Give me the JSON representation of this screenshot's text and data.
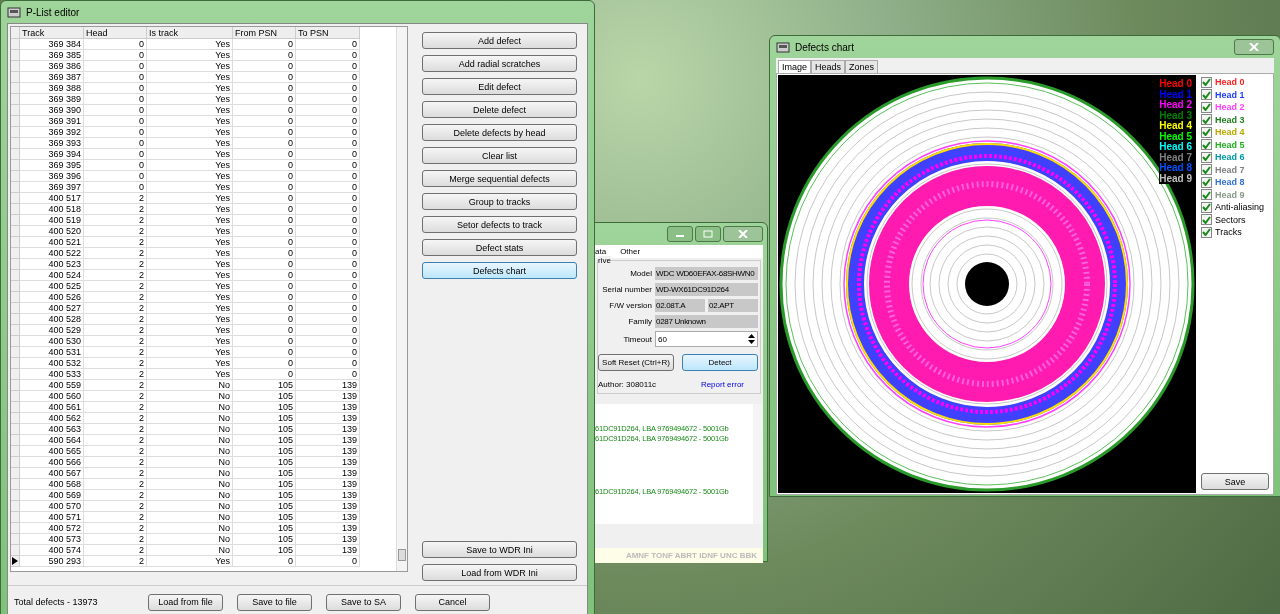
{
  "plist_editor": {
    "title": "P-List editor",
    "columns": [
      "Track",
      "Head",
      "Is track",
      "From PSN",
      "To PSN"
    ],
    "rows": [
      {
        "track": "369 384",
        "head": "0",
        "is_track": "Yes",
        "from_psn": "0",
        "to_psn": "0",
        "selected": false
      },
      {
        "track": "369 385",
        "head": "0",
        "is_track": "Yes",
        "from_psn": "0",
        "to_psn": "0",
        "selected": false
      },
      {
        "track": "369 386",
        "head": "0",
        "is_track": "Yes",
        "from_psn": "0",
        "to_psn": "0",
        "selected": false
      },
      {
        "track": "369 387",
        "head": "0",
        "is_track": "Yes",
        "from_psn": "0",
        "to_psn": "0",
        "selected": false
      },
      {
        "track": "369 388",
        "head": "0",
        "is_track": "Yes",
        "from_psn": "0",
        "to_psn": "0",
        "selected": false
      },
      {
        "track": "369 389",
        "head": "0",
        "is_track": "Yes",
        "from_psn": "0",
        "to_psn": "0",
        "selected": false
      },
      {
        "track": "369 390",
        "head": "0",
        "is_track": "Yes",
        "from_psn": "0",
        "to_psn": "0",
        "selected": false
      },
      {
        "track": "369 391",
        "head": "0",
        "is_track": "Yes",
        "from_psn": "0",
        "to_psn": "0",
        "selected": false
      },
      {
        "track": "369 392",
        "head": "0",
        "is_track": "Yes",
        "from_psn": "0",
        "to_psn": "0",
        "selected": false
      },
      {
        "track": "369 393",
        "head": "0",
        "is_track": "Yes",
        "from_psn": "0",
        "to_psn": "0",
        "selected": false
      },
      {
        "track": "369 394",
        "head": "0",
        "is_track": "Yes",
        "from_psn": "0",
        "to_psn": "0",
        "selected": false
      },
      {
        "track": "369 395",
        "head": "0",
        "is_track": "Yes",
        "from_psn": "0",
        "to_psn": "0",
        "selected": false
      },
      {
        "track": "369 396",
        "head": "0",
        "is_track": "Yes",
        "from_psn": "0",
        "to_psn": "0",
        "selected": false
      },
      {
        "track": "369 397",
        "head": "0",
        "is_track": "Yes",
        "from_psn": "0",
        "to_psn": "0",
        "selected": false
      },
      {
        "track": "400 517",
        "head": "2",
        "is_track": "Yes",
        "from_psn": "0",
        "to_psn": "0",
        "selected": false
      },
      {
        "track": "400 518",
        "head": "2",
        "is_track": "Yes",
        "from_psn": "0",
        "to_psn": "0",
        "selected": false
      },
      {
        "track": "400 519",
        "head": "2",
        "is_track": "Yes",
        "from_psn": "0",
        "to_psn": "0",
        "selected": false
      },
      {
        "track": "400 520",
        "head": "2",
        "is_track": "Yes",
        "from_psn": "0",
        "to_psn": "0",
        "selected": false
      },
      {
        "track": "400 521",
        "head": "2",
        "is_track": "Yes",
        "from_psn": "0",
        "to_psn": "0",
        "selected": false
      },
      {
        "track": "400 522",
        "head": "2",
        "is_track": "Yes",
        "from_psn": "0",
        "to_psn": "0",
        "selected": false
      },
      {
        "track": "400 523",
        "head": "2",
        "is_track": "Yes",
        "from_psn": "0",
        "to_psn": "0",
        "selected": false
      },
      {
        "track": "400 524",
        "head": "2",
        "is_track": "Yes",
        "from_psn": "0",
        "to_psn": "0",
        "selected": false
      },
      {
        "track": "400 525",
        "head": "2",
        "is_track": "Yes",
        "from_psn": "0",
        "to_psn": "0",
        "selected": false
      },
      {
        "track": "400 526",
        "head": "2",
        "is_track": "Yes",
        "from_psn": "0",
        "to_psn": "0",
        "selected": false
      },
      {
        "track": "400 527",
        "head": "2",
        "is_track": "Yes",
        "from_psn": "0",
        "to_psn": "0",
        "selected": false
      },
      {
        "track": "400 528",
        "head": "2",
        "is_track": "Yes",
        "from_psn": "0",
        "to_psn": "0",
        "selected": false
      },
      {
        "track": "400 529",
        "head": "2",
        "is_track": "Yes",
        "from_psn": "0",
        "to_psn": "0",
        "selected": false
      },
      {
        "track": "400 530",
        "head": "2",
        "is_track": "Yes",
        "from_psn": "0",
        "to_psn": "0",
        "selected": false
      },
      {
        "track": "400 531",
        "head": "2",
        "is_track": "Yes",
        "from_psn": "0",
        "to_psn": "0",
        "selected": false
      },
      {
        "track": "400 532",
        "head": "2",
        "is_track": "Yes",
        "from_psn": "0",
        "to_psn": "0",
        "selected": false
      },
      {
        "track": "400 533",
        "head": "2",
        "is_track": "Yes",
        "from_psn": "0",
        "to_psn": "0",
        "selected": false
      },
      {
        "track": "400 559",
        "head": "2",
        "is_track": "No",
        "from_psn": "105",
        "to_psn": "139",
        "selected": false
      },
      {
        "track": "400 560",
        "head": "2",
        "is_track": "No",
        "from_psn": "105",
        "to_psn": "139",
        "selected": false
      },
      {
        "track": "400 561",
        "head": "2",
        "is_track": "No",
        "from_psn": "105",
        "to_psn": "139",
        "selected": false
      },
      {
        "track": "400 562",
        "head": "2",
        "is_track": "No",
        "from_psn": "105",
        "to_psn": "139",
        "selected": false
      },
      {
        "track": "400 563",
        "head": "2",
        "is_track": "No",
        "from_psn": "105",
        "to_psn": "139",
        "selected": false
      },
      {
        "track": "400 564",
        "head": "2",
        "is_track": "No",
        "from_psn": "105",
        "to_psn": "139",
        "selected": false
      },
      {
        "track": "400 565",
        "head": "2",
        "is_track": "No",
        "from_psn": "105",
        "to_psn": "139",
        "selected": false
      },
      {
        "track": "400 566",
        "head": "2",
        "is_track": "No",
        "from_psn": "105",
        "to_psn": "139",
        "selected": false
      },
      {
        "track": "400 567",
        "head": "2",
        "is_track": "No",
        "from_psn": "105",
        "to_psn": "139",
        "selected": false
      },
      {
        "track": "400 568",
        "head": "2",
        "is_track": "No",
        "from_psn": "105",
        "to_psn": "139",
        "selected": false
      },
      {
        "track": "400 569",
        "head": "2",
        "is_track": "No",
        "from_psn": "105",
        "to_psn": "139",
        "selected": false
      },
      {
        "track": "400 570",
        "head": "2",
        "is_track": "No",
        "from_psn": "105",
        "to_psn": "139",
        "selected": false
      },
      {
        "track": "400 571",
        "head": "2",
        "is_track": "No",
        "from_psn": "105",
        "to_psn": "139",
        "selected": false
      },
      {
        "track": "400 572",
        "head": "2",
        "is_track": "No",
        "from_psn": "105",
        "to_psn": "139",
        "selected": false
      },
      {
        "track": "400 573",
        "head": "2",
        "is_track": "No",
        "from_psn": "105",
        "to_psn": "139",
        "selected": false
      },
      {
        "track": "400 574",
        "head": "2",
        "is_track": "No",
        "from_psn": "105",
        "to_psn": "139",
        "selected": false
      },
      {
        "track": "590 293",
        "head": "2",
        "is_track": "Yes",
        "from_psn": "0",
        "to_psn": "0",
        "selected": true
      }
    ],
    "actions": [
      {
        "label": "Add defect",
        "focused": false
      },
      {
        "label": "Add radial scratches",
        "focused": false
      },
      {
        "label": "Edit defect",
        "focused": false
      },
      {
        "label": "Delete defect",
        "focused": false
      },
      {
        "label": "Delete defects by head",
        "focused": false
      },
      {
        "label": "Clear list",
        "focused": false
      },
      {
        "label": "Merge sequential defects",
        "focused": false
      },
      {
        "label": "Group to tracks",
        "focused": false
      },
      {
        "label": "Setor defects to track",
        "focused": false
      },
      {
        "label": "Defect stats",
        "focused": false
      },
      {
        "label": "Defects chart",
        "focused": true
      }
    ],
    "ini_buttons": [
      "Save to WDR Ini",
      "Load from WDR Ini"
    ],
    "total": "Total defects - 13973",
    "footer_buttons": [
      "Load from file",
      "Save to file",
      "Save to SA",
      "Cancel"
    ]
  },
  "drive_window": {
    "menu": [
      "ata",
      "Other"
    ],
    "group_title": "rive",
    "fields": [
      {
        "label": "Model",
        "values": [
          "WDC WD60EFAX-68SHWN0"
        ]
      },
      {
        "label": "Serial number",
        "values": [
          "WD-WX61DC91D264"
        ]
      },
      {
        "label": "F/W version",
        "values": [
          "02.08T.A",
          "02.APT"
        ]
      },
      {
        "label": "Family",
        "values": [
          "0287 Unknown"
        ]
      }
    ],
    "timeout": {
      "label": "Timeout",
      "value": "60"
    },
    "buttons": [
      {
        "label": "Soft Reset (Ctrl+R)",
        "focused": false
      },
      {
        "label": "Detect",
        "focused": true
      }
    ],
    "author": "Author: 308011c",
    "report_link": "Report error",
    "log": [
      "61DC91D264, LBA 9769494672 - 5001Gb",
      "61DC91D264, LBA 9769494672 - 5001Gb",
      "61DC91D264, LBA 9769494672 - 5001Gb"
    ],
    "status_flags": "AMNF TONF ABRT IDNF UNC BBK"
  },
  "defects_chart": {
    "title": "Defects chart",
    "tabs": [
      {
        "label": "Image",
        "selected": true
      },
      {
        "label": "Heads",
        "selected": false
      },
      {
        "label": "Zones",
        "selected": false
      }
    ],
    "legend": [
      {
        "label": "Head 0",
        "color": "#ff0000"
      },
      {
        "label": "Head 1",
        "color": "#0000ff"
      },
      {
        "label": "Head 2",
        "color": "#ff00ff"
      },
      {
        "label": "Head 3",
        "color": "#008000"
      },
      {
        "label": "Head 4",
        "color": "#ffff00"
      },
      {
        "label": "Head 5",
        "color": "#00ff00"
      },
      {
        "label": "Head 6",
        "color": "#00ffff"
      },
      {
        "label": "Head 7",
        "color": "#808080"
      },
      {
        "label": "Head 8",
        "color": "#0050ff"
      },
      {
        "label": "Head 9",
        "color": "#c0c0c0"
      }
    ],
    "options": [
      {
        "label": "Head 0",
        "checked": true,
        "color": "#ff2020"
      },
      {
        "label": "Head 1",
        "checked": true,
        "color": "#2040ff"
      },
      {
        "label": "Head 2",
        "checked": true,
        "color": "#ff40ff"
      },
      {
        "label": "Head 3",
        "checked": true,
        "color": "#208020"
      },
      {
        "label": "Head 4",
        "checked": true,
        "color": "#b8a800"
      },
      {
        "label": "Head 5",
        "checked": true,
        "color": "#20b020"
      },
      {
        "label": "Head 6",
        "checked": true,
        "color": "#0098a0"
      },
      {
        "label": "Head 7",
        "checked": true,
        "color": "#808080"
      },
      {
        "label": "Head 8",
        "checked": true,
        "color": "#3070d0"
      },
      {
        "label": "Head 9",
        "checked": true,
        "color": "#889888"
      },
      {
        "label": "Anti-aliasing",
        "checked": true
      },
      {
        "label": "Sectors",
        "checked": true
      },
      {
        "label": "Tracks",
        "checked": true
      }
    ],
    "save": "Save"
  }
}
